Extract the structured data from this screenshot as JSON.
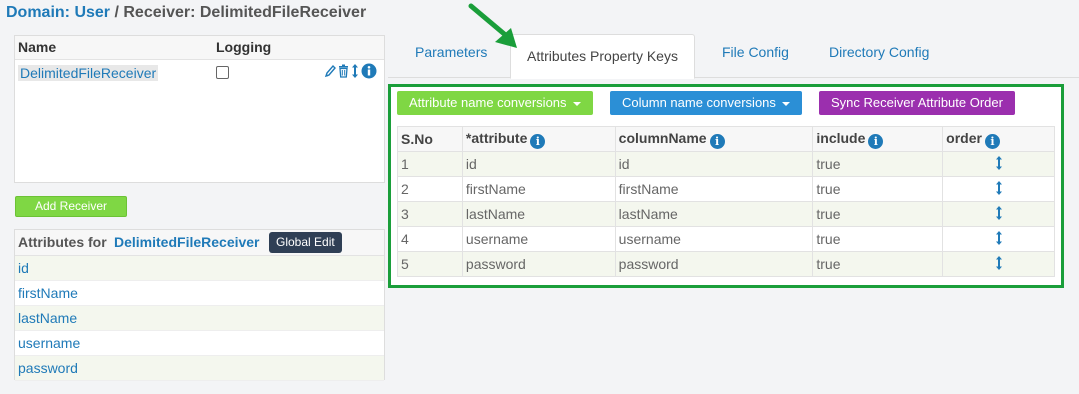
{
  "breadcrumb": {
    "domain_label": "Domain:",
    "domain_value": "User",
    "separator": " / ",
    "receiver_label": "Receiver:",
    "receiver_value": "DelimitedFileReceiver"
  },
  "receivers": {
    "col_name": "Name",
    "col_logging": "Logging",
    "rows": [
      {
        "name": "DelimitedFileReceiver",
        "logging": false
      }
    ]
  },
  "add_receiver_label": "Add Receiver",
  "attributes_panel": {
    "title_prefix": "Attributes for",
    "title_receiver": "DelimitedFileReceiver",
    "global_edit_label": "Global Edit",
    "items": [
      "id",
      "firstName",
      "lastName",
      "username",
      "password"
    ]
  },
  "tabs": [
    {
      "label": "Parameters",
      "active": false
    },
    {
      "label": "Attributes Property Keys",
      "active": true
    },
    {
      "label": "File Config",
      "active": false
    },
    {
      "label": "Directory Config",
      "active": false
    }
  ],
  "toolbar": {
    "attr_conv_label": "Attribute name conversions",
    "col_conv_label": "Column name conversions",
    "sync_label": "Sync Receiver Attribute Order"
  },
  "grid": {
    "headers": {
      "sno": "S.No",
      "attribute": "*attribute",
      "column": "columnName",
      "include": "include",
      "order": "order"
    },
    "rows": [
      {
        "sno": "1",
        "attribute": "id",
        "column": "id",
        "include": "true"
      },
      {
        "sno": "2",
        "attribute": "firstName",
        "column": "firstName",
        "include": "true"
      },
      {
        "sno": "3",
        "attribute": "lastName",
        "column": "lastName",
        "include": "true"
      },
      {
        "sno": "4",
        "attribute": "username",
        "column": "username",
        "include": "true"
      },
      {
        "sno": "5",
        "attribute": "password",
        "column": "password",
        "include": "true"
      }
    ]
  },
  "colors": {
    "link": "#1f7ab8",
    "green_button": "#7fd744",
    "blue_button": "#2b8fd6",
    "purple_button": "#9b2fae",
    "highlight_box": "#1a9e3a",
    "annotation_arrow": "#1a9e3a"
  },
  "icons": [
    "pencil-icon",
    "trash-icon",
    "sort-arrows-icon",
    "info-icon",
    "caret-down-icon",
    "annotation-arrow"
  ]
}
